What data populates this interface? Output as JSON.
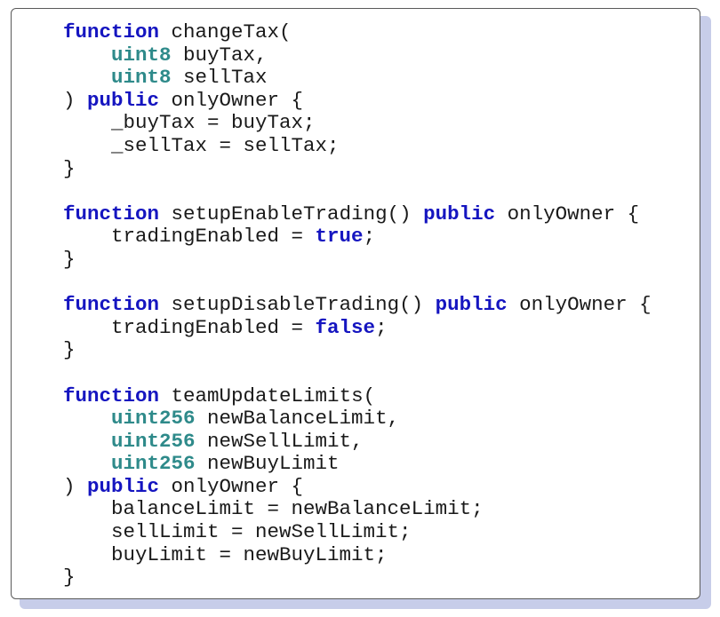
{
  "colors": {
    "keyword": "#1515c0",
    "type": "#2e8a8a",
    "text": "#1a1a1a",
    "border": "#5a5a5a",
    "shadow": "#c7cde9"
  },
  "code": {
    "lines": [
      [
        {
          "t": "function",
          "c": "kw"
        },
        {
          "t": " changeTax(",
          "c": ""
        }
      ],
      [
        {
          "t": "    ",
          "c": ""
        },
        {
          "t": "uint8",
          "c": "ty"
        },
        {
          "t": " buyTax,",
          "c": ""
        }
      ],
      [
        {
          "t": "    ",
          "c": ""
        },
        {
          "t": "uint8",
          "c": "ty"
        },
        {
          "t": " sellTax",
          "c": ""
        }
      ],
      [
        {
          "t": ") ",
          "c": ""
        },
        {
          "t": "public",
          "c": "kw"
        },
        {
          "t": " onlyOwner {",
          "c": ""
        }
      ],
      [
        {
          "t": "    _buyTax = buyTax;",
          "c": ""
        }
      ],
      [
        {
          "t": "    _sellTax = sellTax;",
          "c": ""
        }
      ],
      [
        {
          "t": "}",
          "c": ""
        }
      ],
      [
        {
          "t": "",
          "c": ""
        }
      ],
      [
        {
          "t": "function",
          "c": "kw"
        },
        {
          "t": " setupEnableTrading() ",
          "c": ""
        },
        {
          "t": "public",
          "c": "kw"
        },
        {
          "t": " onlyOwner {",
          "c": ""
        }
      ],
      [
        {
          "t": "    tradingEnabled = ",
          "c": ""
        },
        {
          "t": "true",
          "c": "kw"
        },
        {
          "t": ";",
          "c": ""
        }
      ],
      [
        {
          "t": "}",
          "c": ""
        }
      ],
      [
        {
          "t": "",
          "c": ""
        }
      ],
      [
        {
          "t": "function",
          "c": "kw"
        },
        {
          "t": " setupDisableTrading() ",
          "c": ""
        },
        {
          "t": "public",
          "c": "kw"
        },
        {
          "t": " onlyOwner {",
          "c": ""
        }
      ],
      [
        {
          "t": "    tradingEnabled = ",
          "c": ""
        },
        {
          "t": "false",
          "c": "kw"
        },
        {
          "t": ";",
          "c": ""
        }
      ],
      [
        {
          "t": "}",
          "c": ""
        }
      ],
      [
        {
          "t": "",
          "c": ""
        }
      ],
      [
        {
          "t": "function",
          "c": "kw"
        },
        {
          "t": " teamUpdateLimits(",
          "c": ""
        }
      ],
      [
        {
          "t": "    ",
          "c": ""
        },
        {
          "t": "uint256",
          "c": "ty"
        },
        {
          "t": " newBalanceLimit,",
          "c": ""
        }
      ],
      [
        {
          "t": "    ",
          "c": ""
        },
        {
          "t": "uint256",
          "c": "ty"
        },
        {
          "t": " newSellLimit,",
          "c": ""
        }
      ],
      [
        {
          "t": "    ",
          "c": ""
        },
        {
          "t": "uint256",
          "c": "ty"
        },
        {
          "t": " newBuyLimit",
          "c": ""
        }
      ],
      [
        {
          "t": ") ",
          "c": ""
        },
        {
          "t": "public",
          "c": "kw"
        },
        {
          "t": " onlyOwner {",
          "c": ""
        }
      ],
      [
        {
          "t": "    balanceLimit = newBalanceLimit;",
          "c": ""
        }
      ],
      [
        {
          "t": "    sellLimit = newSellLimit;",
          "c": ""
        }
      ],
      [
        {
          "t": "    buyLimit = newBuyLimit;",
          "c": ""
        }
      ],
      [
        {
          "t": "}",
          "c": ""
        }
      ]
    ]
  }
}
